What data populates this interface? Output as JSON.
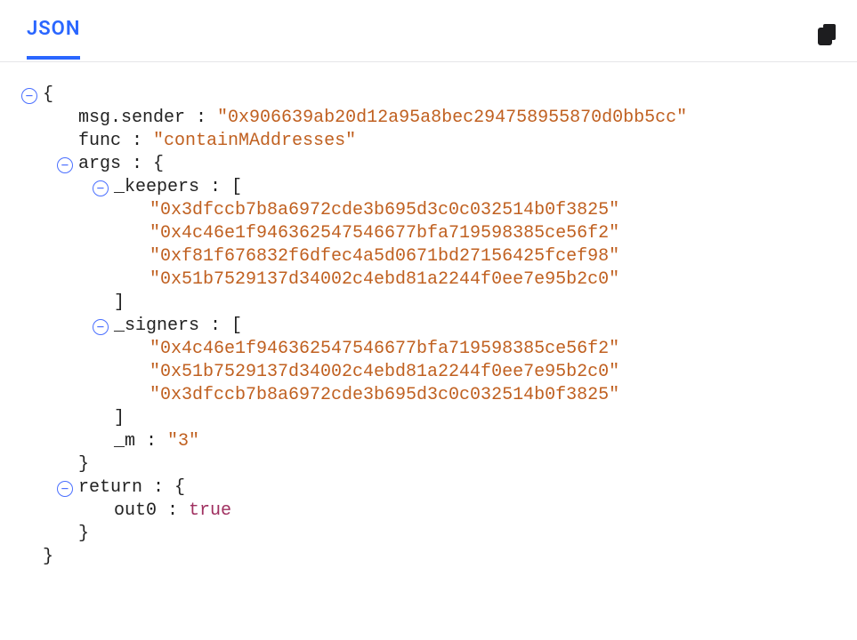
{
  "header": {
    "tab_label": "JSON"
  },
  "json": {
    "msg_sender_key": "msg.sender",
    "msg_sender_val": "\"0x906639ab20d12a95a8bec294758955870d0bb5cc\"",
    "func_key": "func",
    "func_val": "\"containMAddresses\"",
    "args_key": "args",
    "keepers_key": "_keepers",
    "keepers": [
      "\"0x3dfccb7b8a6972cde3b695d3c0c032514b0f3825\"",
      "\"0x4c46e1f946362547546677bfa719598385ce56f2\"",
      "\"0xf81f676832f6dfec4a5d0671bd27156425fcef98\"",
      "\"0x51b7529137d34002c4ebd81a2244f0ee7e95b2c0\""
    ],
    "signers_key": "_signers",
    "signers": [
      "\"0x4c46e1f946362547546677bfa719598385ce56f2\"",
      "\"0x51b7529137d34002c4ebd81a2244f0ee7e95b2c0\"",
      "\"0x3dfccb7b8a6972cde3b695d3c0c032514b0f3825\""
    ],
    "m_key": "_m",
    "m_val": "\"3\"",
    "return_key": "return",
    "out0_key": "out0",
    "out0_val": "true"
  }
}
